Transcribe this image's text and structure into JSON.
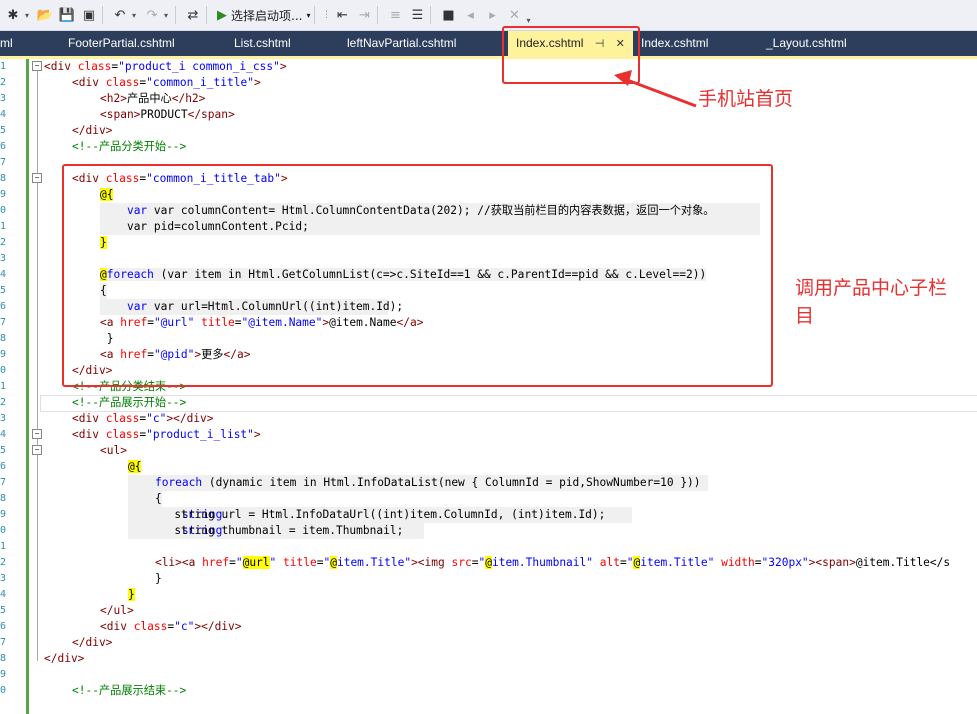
{
  "toolbar": {
    "start_label": "选择启动项..."
  },
  "tabs": [
    {
      "label": "ml",
      "active": false
    },
    {
      "label": "FooterPartial.cshtml",
      "active": false
    },
    {
      "label": "List.cshtml",
      "active": false
    },
    {
      "label": "leftNavPartial.cshtml",
      "active": false
    },
    {
      "label": "Index.cshtml",
      "active": true,
      "pin": "⊣",
      "close": "✕"
    },
    {
      "label": "Index.cshtml",
      "active": false
    },
    {
      "label": "_Layout.cshtml",
      "active": false
    }
  ],
  "line_numbers": [
    "1",
    "2",
    "3",
    "4",
    "5",
    "6",
    "7",
    "8",
    "9",
    "0",
    "1",
    "2",
    "3",
    "4",
    "5",
    "6",
    "7",
    "8",
    "9",
    "0",
    "1",
    "2",
    "3",
    "4",
    "5",
    "6",
    "7",
    "8",
    "9",
    "0",
    "1",
    "2",
    "3",
    "4",
    "5",
    "6",
    "7",
    "8",
    "9",
    "0"
  ],
  "annotations": {
    "tab_note": "手机站首页",
    "box_note_line1": "调用产品中心子栏",
    "box_note_line2": "目"
  },
  "code": {
    "l1_cls": "product_i common_i_css",
    "l2_cls": "common_i_title",
    "l3_text": "产品中心",
    "l4_text": "PRODUCT",
    "l6_cmt": "<!--产品分类开始-->",
    "l8_cls": "common_i_title_tab",
    "l10_code": "var columnContent= Html.ColumnContentData(202); //获取当前栏目的内容表数据，返回一个对象。",
    "l11_code": "var pid=columnContent.Pcid;",
    "l14_code": " (var item in Html.GetColumnList(c=>c.SiteId==1 && c.ParentId==pid && c.Level==2))",
    "l16_code": "var url=Html.ColumnUrl((int)item.Id);",
    "l17_href": "\"@url\"",
    "l17_title": "\"@item.Name\"",
    "l17_text": "@item.Name",
    "l19_href": "\"@pid\"",
    "l19_text": "更多",
    "l21_cmt": "<!--产品分类结束-->",
    "l22_cmt": "<!--产品展示开始-->",
    "l23_cls": "\"c\"",
    "l24_cls": "\"product_i_list\"",
    "l27_code": " (dynamic item in Html.InfoDataList(new { ColumnId = pid,ShowNumber=10 }))",
    "l29_code": "string url = Html.InfoDataUrl((int)item.ColumnId, (int)item.Id);",
    "l30_code": "string thumbnail = item.Thumbnail;",
    "l32_alt_width": "\"320px\"",
    "l32_tail": "@item.Title</s",
    "l36_cls": "\"c\"",
    "l40_cmt": "<!--产品展示结束-->"
  }
}
